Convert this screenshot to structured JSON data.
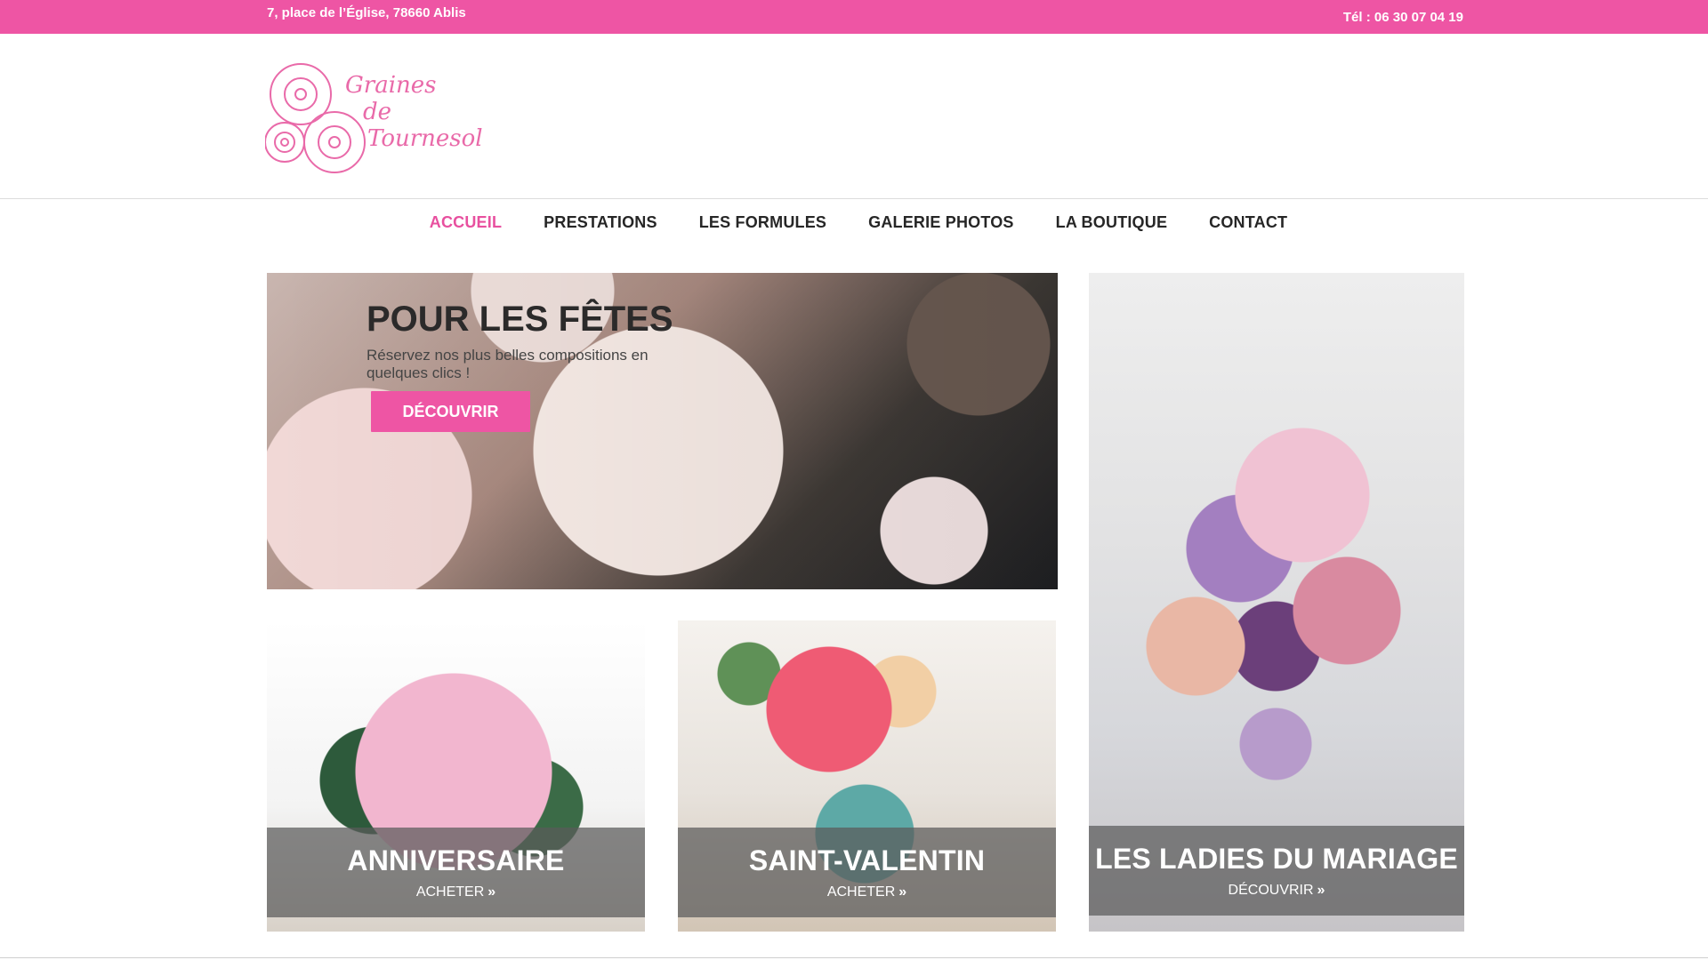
{
  "topbar": {
    "address": "7, place de l’Église, 78660 Ablis",
    "phone": "Tél :  06 30 07 04 19"
  },
  "brand": {
    "logo_lines": [
      "Graines",
      "de",
      "Tournesol"
    ],
    "accent": "#ee55a4"
  },
  "nav": {
    "items": [
      {
        "label": "ACCUEIL",
        "active": true
      },
      {
        "label": "PRESTATIONS",
        "active": false
      },
      {
        "label": "LES FORMULES",
        "active": false
      },
      {
        "label": "GALERIE PHOTOS",
        "active": false
      },
      {
        "label": "LA BOUTIQUE",
        "active": false
      },
      {
        "label": "CONTACT",
        "active": false
      }
    ]
  },
  "hero": {
    "title": "POUR LES FÊTES",
    "text": "Réservez nos plus belles compositions en quelques clics !",
    "button": "DÉCOUVRIR"
  },
  "cards": [
    {
      "title": "ANNIVERSAIRE",
      "cta": "ACHETER"
    },
    {
      "title": "SAINT-VALENTIN",
      "cta": "ACHETER"
    },
    {
      "title": "LES LADIES DU MARIAGE",
      "cta": "DÉCOUVRIR"
    }
  ],
  "icons": {
    "logo_flower": "sunflower-outline-icon",
    "chevron": "double-chevron-right-icon"
  }
}
